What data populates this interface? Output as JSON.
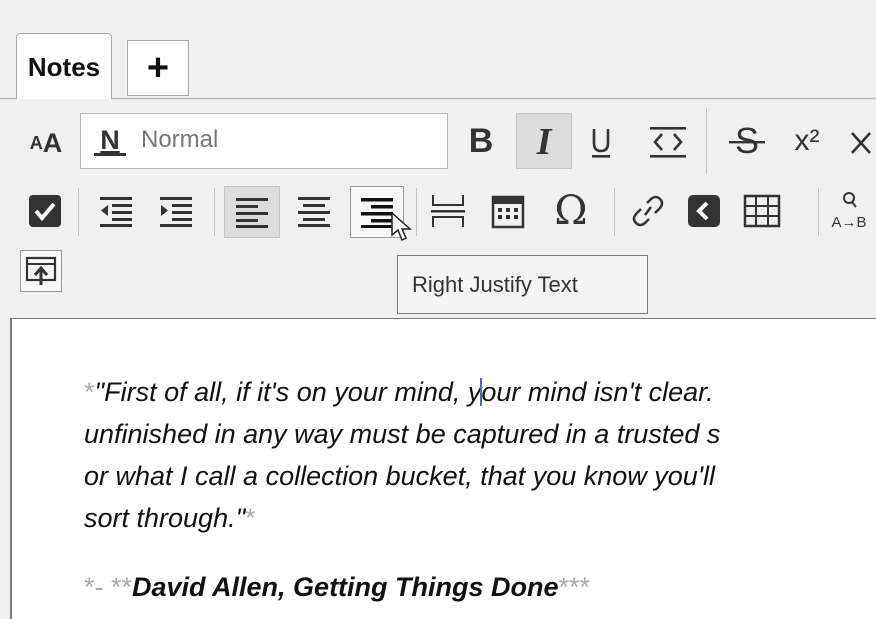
{
  "tabs": [
    {
      "label": "Notes"
    },
    {
      "label": "+"
    }
  ],
  "toolbar": {
    "font_size_label": "AA",
    "style_selector_value": "Normal",
    "style_icon_letter": "N",
    "bold_label": "B",
    "italic_label": "I",
    "underline_label": "U",
    "superscript_label": "x²"
  },
  "tooltip": {
    "text": "Right Justify Text"
  },
  "editor": {
    "line1_prefix": "*",
    "line1_a": "\"First of all, if it's on your mind, y",
    "line1_b": "our mind isn't clear.",
    "line2": "unfinished in any way must be captured in a trusted s",
    "line3": "or what I call a collection bucket, that you know you'll",
    "line4": "sort through.\"",
    "line4_suffix": "*",
    "attrib_prefix": "*- **",
    "attrib_text": "David Allen, Getting Things Done",
    "attrib_suffix": "***"
  },
  "colors": {
    "accent": "#4a6fa5",
    "toolbar_bg": "#f0f0f0",
    "markup": "#aaaaaa"
  }
}
